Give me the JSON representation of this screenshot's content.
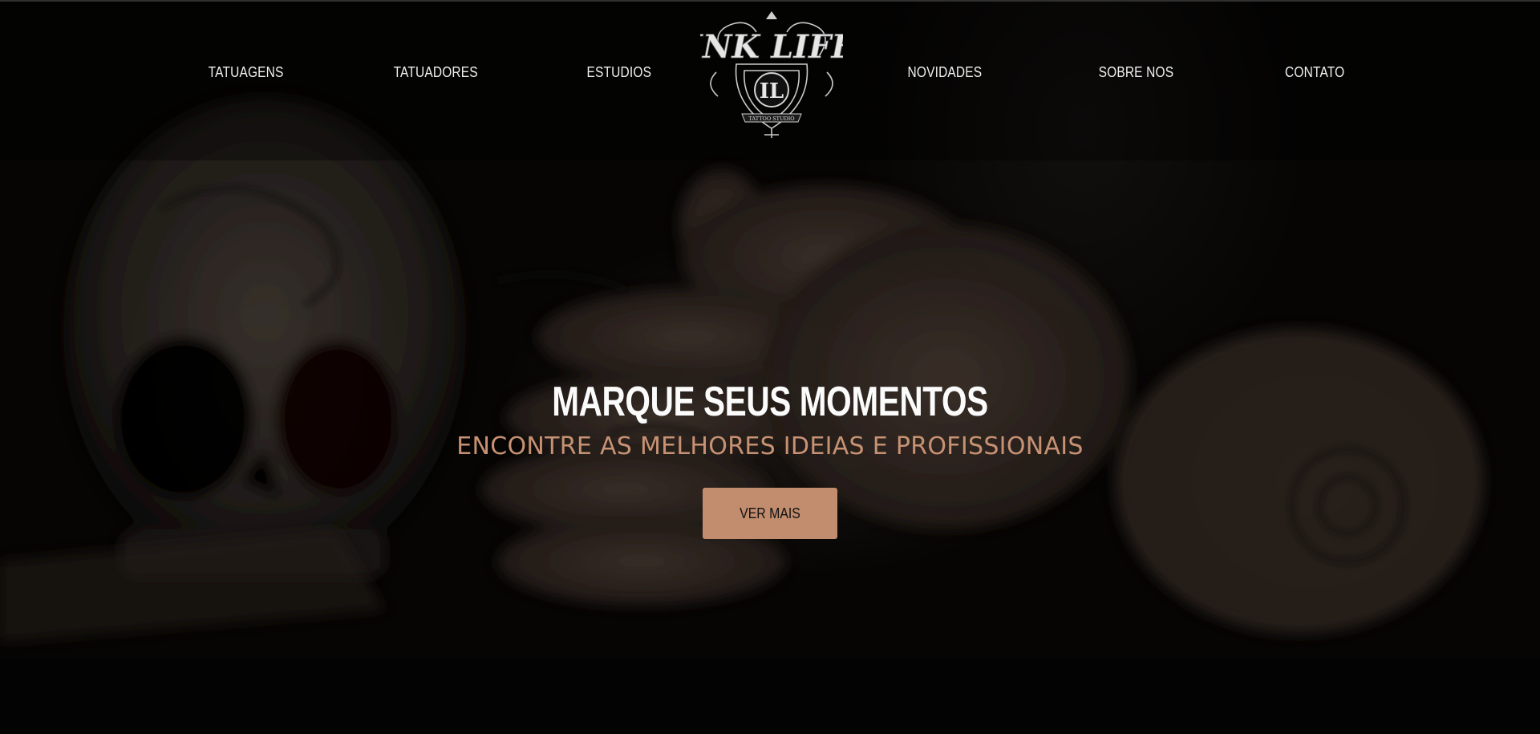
{
  "nav": {
    "left_items": [
      "TATUAGENS",
      "TATUADORES",
      "ESTUDIOS"
    ],
    "right_items": [
      "NOVIDADES",
      "SOBRE NOS",
      "CONTATO"
    ]
  },
  "logo": {
    "text": "INK LIFE",
    "tagline": "TATTOO STUDIO",
    "monogram": "IL"
  },
  "hero": {
    "headline": "MARQUE SEUS MOMENTOS",
    "subheadline": "ENCONTRE AS MELHORES IDEIAS E PROFISSIONAIS",
    "cta_label": "VER MAIS"
  },
  "colors": {
    "accent": "#c28d6e",
    "subheadline": "#c79273",
    "background": "#060504",
    "text": "#fbfbfb"
  }
}
